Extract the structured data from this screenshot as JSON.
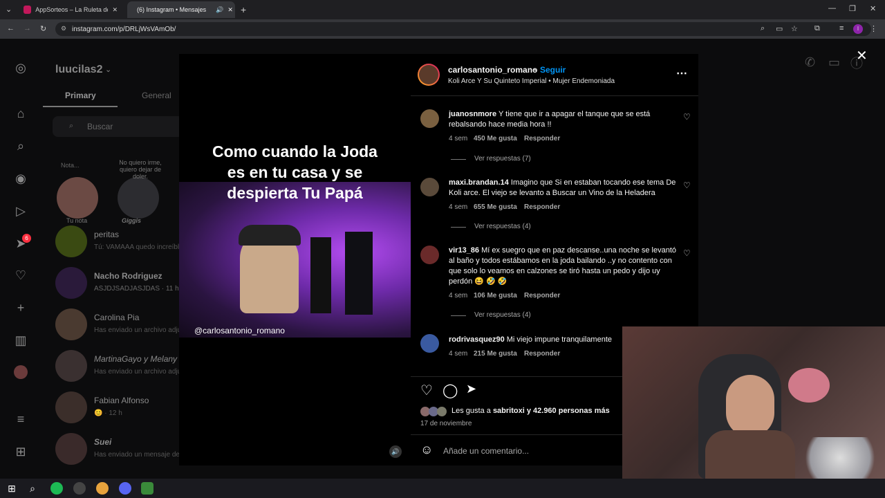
{
  "browser": {
    "tabs": [
      {
        "title": "AppSorteos – La Ruleta de la Su"
      },
      {
        "title": "(6) Instagram • Mensajes"
      }
    ],
    "url": "instagram.com/p/DRLjWsVAmOb/"
  },
  "ig": {
    "username": "luucilas2",
    "tabs": [
      "Primary",
      "General"
    ],
    "search_placeholder": "Buscar",
    "notes": [
      {
        "label": "Tu nota",
        "bubble": "Nota..."
      },
      {
        "label": "Giggis",
        "bubble": "No quiero irme, quiero dejar de doler."
      }
    ],
    "threads": [
      {
        "name": "peritas",
        "preview": "Tú: VAMAAA quedo increíbl"
      },
      {
        "name": "Nacho Rodriguez",
        "preview": "ASJDJSADJASJDAS · 11 h"
      },
      {
        "name": "Carolina Pia",
        "preview": "Has enviado un archivo adju"
      },
      {
        "name": "MartinaGayo y Melany",
        "preview": "Has enviado un archivo adju"
      },
      {
        "name": "Fabian Alfonso",
        "preview": "😊 · 12 h"
      },
      {
        "name": "Suei",
        "preview": "Has enviado un mensaje de"
      }
    ],
    "badge_count": "6"
  },
  "post": {
    "video_caption": "Como cuando la  Joda es en tu casa y se despierta Tu Papá",
    "watermark": "@carlosantonio_romano",
    "author": "carlosantonio_romano",
    "follow": "Seguir",
    "audio": "Koli Arce Y Su Quinteto Imperial • Mujer Endemoniada",
    "comments": [
      {
        "user": "juanosnmore",
        "text": "Y tiene que ir a apagar el tanque que se está rebalsando hace media hora !!",
        "age": "4 sem",
        "likes": "450 Me gusta",
        "reply": "Responder",
        "replies": "Ver respuestas (7)"
      },
      {
        "user": "maxi.brandan.14",
        "text": "Imagino que Si en estaban tocando ese tema De Koli arce. El viejo se levanto a Buscar un Vino de la Heladera",
        "age": "4 sem",
        "likes": "655 Me gusta",
        "reply": "Responder",
        "replies": "Ver respuestas (4)"
      },
      {
        "user": "vir13_86",
        "text": "Mí ex suegro que en paz descanse..una noche se levantó al baño y todos estábamos en la joda bailando ..y no contento con que solo lo veamos en calzones se tiró hasta un pedo y dijo uy perdón 😆 🤣 🤣",
        "age": "4 sem",
        "likes": "106 Me gusta",
        "reply": "Responder",
        "replies": "Ver respuestas (4)"
      },
      {
        "user": "rodrivasquez90",
        "text": "Mi viejo impune tranquilamente",
        "age": "4 sem",
        "likes": "215 Me gusta",
        "reply": "Responder",
        "replies": ""
      }
    ],
    "likes_prefix": "Les gusta a ",
    "likes_user": "sabritoxi",
    "likes_suffix": " y 42.960 personas más",
    "date": "17 de noviembre",
    "comment_placeholder": "Añade un comentario..."
  }
}
